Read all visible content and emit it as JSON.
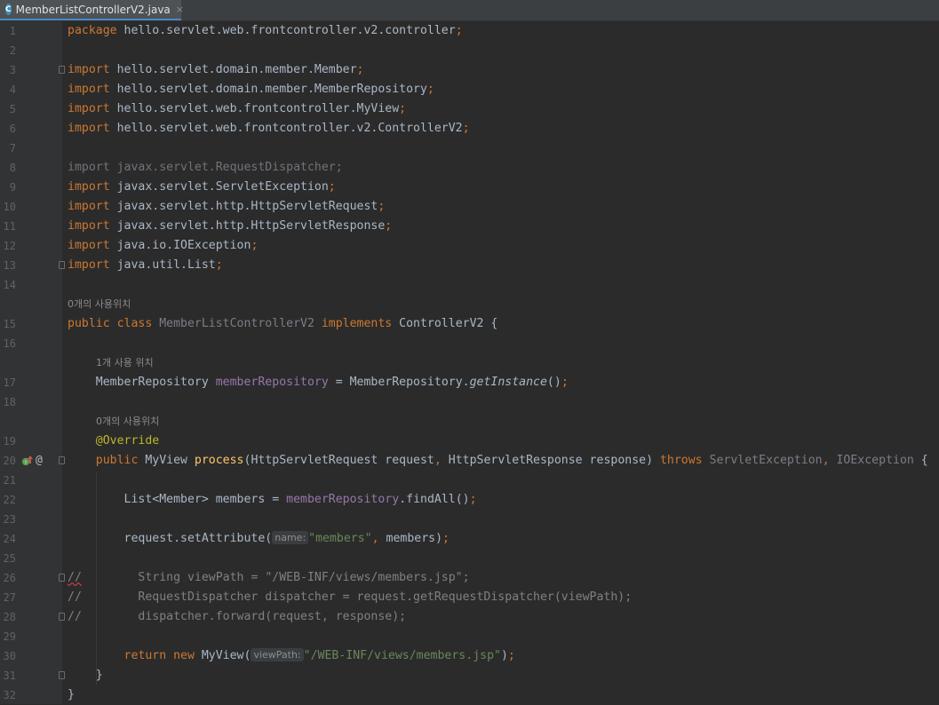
{
  "tab": {
    "label": "MemberListControllerV2.java",
    "icon": "c-class-icon",
    "icon_letter": "C",
    "close": "×"
  },
  "gutter": {
    "override_icon": "@"
  },
  "lines": [
    {
      "n": "1",
      "tokens": [
        [
          "kw",
          "package"
        ],
        [
          "plain",
          " hello.servlet.web.frontcontroller.v2.controller"
        ],
        [
          "kw",
          ";"
        ]
      ]
    },
    {
      "n": "2",
      "tokens": []
    },
    {
      "n": "3",
      "fold": true,
      "tokens": [
        [
          "kw",
          "import"
        ],
        [
          "plain",
          " hello.servlet.domain.member.Member"
        ],
        [
          "kw",
          ";"
        ]
      ]
    },
    {
      "n": "4",
      "tokens": [
        [
          "kw",
          "import"
        ],
        [
          "plain",
          " hello.servlet.domain.member.MemberRepository"
        ],
        [
          "kw",
          ";"
        ]
      ]
    },
    {
      "n": "5",
      "tokens": [
        [
          "kw",
          "import"
        ],
        [
          "plain",
          " hello.servlet.web.frontcontroller.MyView"
        ],
        [
          "kw",
          ";"
        ]
      ]
    },
    {
      "n": "6",
      "tokens": [
        [
          "kw",
          "import"
        ],
        [
          "plain",
          " hello.servlet.web.frontcontroller.v2.ControllerV2"
        ],
        [
          "kw",
          ";"
        ]
      ]
    },
    {
      "n": "7",
      "tokens": []
    },
    {
      "n": "8",
      "tokens": [
        [
          "unused",
          "import javax.servlet.RequestDispatcher;"
        ]
      ]
    },
    {
      "n": "9",
      "tokens": [
        [
          "kw",
          "import"
        ],
        [
          "plain",
          " javax.servlet.ServletException"
        ],
        [
          "kw",
          ";"
        ]
      ]
    },
    {
      "n": "10",
      "tokens": [
        [
          "kw",
          "import"
        ],
        [
          "plain",
          " javax.servlet.http.HttpServletRequest"
        ],
        [
          "kw",
          ";"
        ]
      ]
    },
    {
      "n": "11",
      "tokens": [
        [
          "kw",
          "import"
        ],
        [
          "plain",
          " javax.servlet.http.HttpServletResponse"
        ],
        [
          "kw",
          ";"
        ]
      ]
    },
    {
      "n": "12",
      "tokens": [
        [
          "kw",
          "import"
        ],
        [
          "plain",
          " java.io.IOException"
        ],
        [
          "kw",
          ";"
        ]
      ]
    },
    {
      "n": "13",
      "fold": true,
      "tokens": [
        [
          "kw",
          "import"
        ],
        [
          "plain",
          " java.util.List"
        ],
        [
          "kw",
          ";"
        ]
      ]
    },
    {
      "n": "14",
      "tokens": []
    },
    {
      "hint": "0개의 사용위치",
      "indent": 0
    },
    {
      "n": "15",
      "tokens": [
        [
          "kw",
          "public class "
        ],
        [
          "dim",
          "MemberListControllerV2"
        ],
        [
          "kw",
          " implements "
        ],
        [
          "plain",
          "ControllerV2 {"
        ]
      ]
    },
    {
      "n": "16",
      "tokens": []
    },
    {
      "hint": "1개 사용 위치",
      "indent": 1
    },
    {
      "n": "17",
      "tokens": [
        [
          "plain",
          "    MemberRepository "
        ],
        [
          "field",
          "memberRepository"
        ],
        [
          "plain",
          " = MemberRepository."
        ],
        [
          "ital",
          "getInstance"
        ],
        [
          "plain",
          "()"
        ],
        [
          "kw",
          ";"
        ]
      ]
    },
    {
      "n": "18",
      "tokens": []
    },
    {
      "hint": "0개의 사용위치",
      "indent": 1
    },
    {
      "n": "19",
      "tokens": [
        [
          "ann",
          "    @Override"
        ]
      ]
    },
    {
      "n": "20",
      "fold": true,
      "gutter_icons": true,
      "tokens": [
        [
          "kw",
          "    public "
        ],
        [
          "plain",
          "MyView "
        ],
        [
          "fn",
          "process"
        ],
        [
          "plain",
          "(HttpServletRequest request"
        ],
        [
          "kw",
          ","
        ],
        [
          "plain",
          " HttpServletResponse response) "
        ],
        [
          "kw",
          "throws "
        ],
        [
          "dim",
          "ServletException"
        ],
        [
          "kw",
          ","
        ],
        [
          "dim",
          " IOException"
        ],
        [
          "plain",
          " {"
        ]
      ]
    },
    {
      "n": "21",
      "tokens": []
    },
    {
      "n": "22",
      "tokens": [
        [
          "plain",
          "        List<Member> members = "
        ],
        [
          "field",
          "memberRepository"
        ],
        [
          "plain",
          ".findAll()"
        ],
        [
          "kw",
          ";"
        ]
      ]
    },
    {
      "n": "23",
      "tokens": []
    },
    {
      "n": "24",
      "tokens": [
        [
          "plain",
          "        request.setAttribute("
        ],
        [
          "inlay",
          "name:"
        ],
        [
          "str",
          "\"members\""
        ],
        [
          "kw",
          ","
        ],
        [
          "plain",
          " members)"
        ],
        [
          "kw",
          ";"
        ]
      ]
    },
    {
      "n": "25",
      "tokens": []
    },
    {
      "n": "26",
      "fold": true,
      "tokens": [
        [
          "comment-err",
          "//"
        ],
        [
          "comment",
          "        String viewPath = \"/WEB-INF/views/members.jsp\";"
        ]
      ]
    },
    {
      "n": "27",
      "tokens": [
        [
          "comment",
          "//        RequestDispatcher dispatcher = request.getRequestDispatcher(viewPath);"
        ]
      ]
    },
    {
      "n": "28",
      "fold": true,
      "tokens": [
        [
          "comment",
          "//        dispatcher.forward(request, response);"
        ]
      ]
    },
    {
      "n": "29",
      "tokens": []
    },
    {
      "n": "30",
      "tokens": [
        [
          "kw",
          "        return new "
        ],
        [
          "plain",
          "MyView("
        ],
        [
          "inlay",
          "viewPath:"
        ],
        [
          "str",
          "\"/WEB-INF/views/members.jsp\""
        ],
        [
          "plain",
          ")"
        ],
        [
          "kw",
          ";"
        ]
      ]
    },
    {
      "n": "31",
      "fold": true,
      "tokens": [
        [
          "plain",
          "    }"
        ]
      ]
    },
    {
      "n": "32",
      "tokens": [
        [
          "plain",
          "}"
        ]
      ]
    }
  ]
}
